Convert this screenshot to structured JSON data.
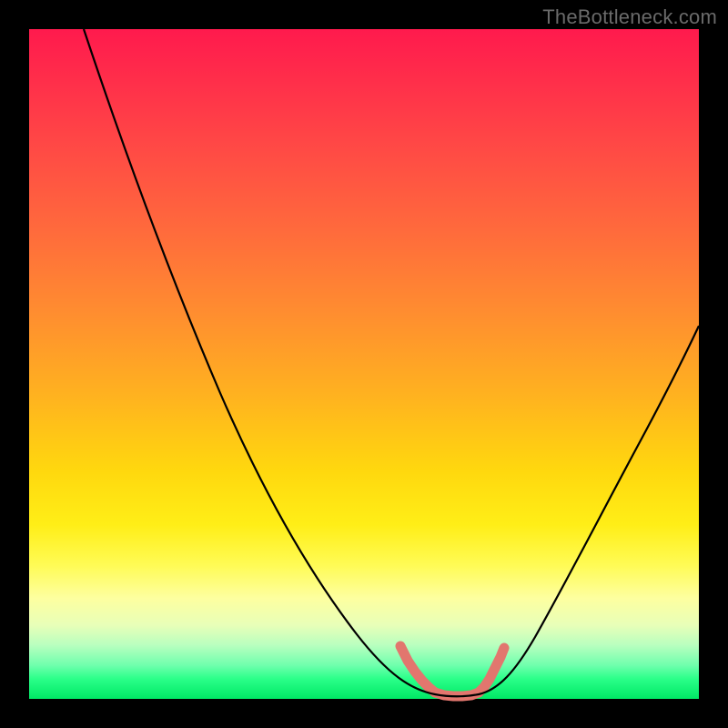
{
  "watermark": "TheBottleneck.com",
  "chart_data": {
    "type": "line",
    "title": "",
    "xlabel": "",
    "ylabel": "",
    "xlim": [
      0,
      100
    ],
    "ylim": [
      0,
      100
    ],
    "grid": false,
    "legend": false,
    "series": [
      {
        "name": "bottleneck-curve",
        "x": [
          8,
          12,
          16,
          20,
          24,
          28,
          32,
          36,
          40,
          44,
          48,
          52,
          56,
          58,
          60,
          62,
          64,
          68,
          72,
          76,
          80,
          84,
          88,
          92,
          96,
          100
        ],
        "y": [
          100,
          92,
          84,
          76,
          68,
          60,
          52,
          44,
          36,
          28,
          20,
          12,
          6,
          3,
          1,
          0,
          0,
          1,
          4,
          10,
          18,
          27,
          36,
          44,
          51,
          57
        ]
      }
    ],
    "highlight_range_x": [
      56,
      67
    ],
    "background_gradient": [
      {
        "stop": 0.0,
        "color": "#ff1a4d"
      },
      {
        "stop": 0.3,
        "color": "#ff6a3c"
      },
      {
        "stop": 0.6,
        "color": "#ffd80e"
      },
      {
        "stop": 0.85,
        "color": "#fdffa0"
      },
      {
        "stop": 1.0,
        "color": "#00e865"
      }
    ],
    "highlight_color": "#e2766e",
    "line_color": "#000000"
  }
}
